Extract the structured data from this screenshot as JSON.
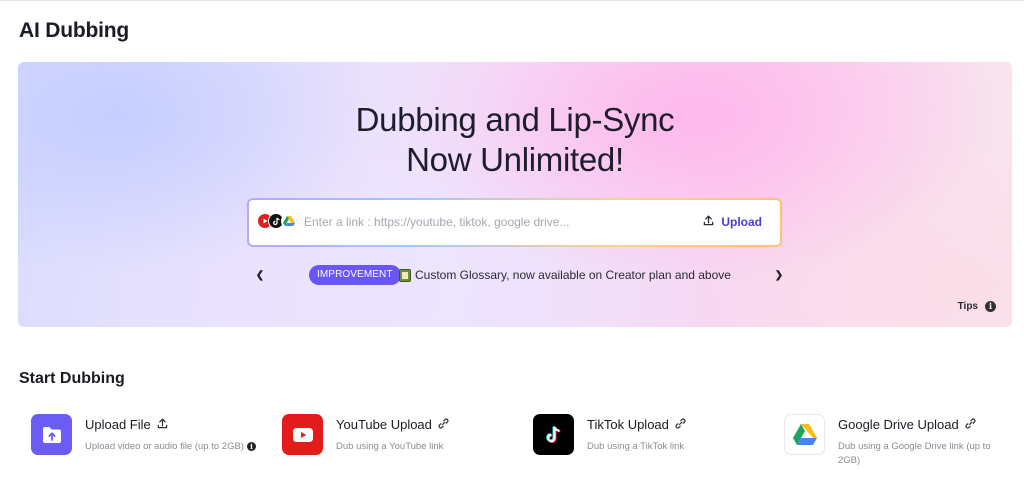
{
  "header": {
    "title": "AI Dubbing"
  },
  "hero": {
    "title_line1": "Dubbing and Lip-Sync",
    "title_line2": "Now Unlimited!",
    "link_input": {
      "placeholder": "Enter a link : https://youtube, tiktok, google drive...",
      "value": ""
    },
    "upload_label": "Upload",
    "source_icons": [
      "youtube-icon",
      "tiktok-icon",
      "google-drive-icon"
    ],
    "announcement": {
      "badge": "IMPROVEMENT",
      "icon": "glossary-book-icon",
      "text": "Custom Glossary, now available on Creator plan and above"
    },
    "tips_label": "Tips"
  },
  "start_dubbing": {
    "title": "Start Dubbing",
    "cards": [
      {
        "title": "Upload File",
        "desc": "Upload video or audio file (up to 2GB)",
        "icon": "upload-folder-icon",
        "action_icon": "upload-icon",
        "color": "#6a5cf5"
      },
      {
        "title": "YouTube Upload",
        "desc": "Dub using a YouTube link",
        "icon": "youtube-icon",
        "action_icon": "link-icon",
        "color": "#e21b1b"
      },
      {
        "title": "TikTok Upload",
        "desc": "Dub using a TikTok link",
        "icon": "tiktok-icon",
        "action_icon": "link-icon",
        "color": "#000000"
      },
      {
        "title": "Google Drive Upload",
        "desc": "Dub using a Google Drive link (up to 2GB)",
        "icon": "google-drive-icon",
        "action_icon": "link-icon",
        "color": "#ffffff"
      }
    ]
  },
  "colors": {
    "accent": "#6a55f5",
    "upload_text": "#4b3bd6"
  }
}
